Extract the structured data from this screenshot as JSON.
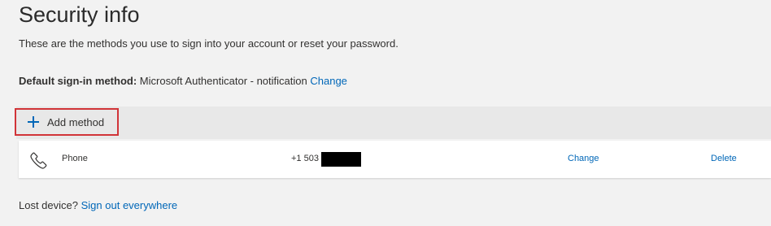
{
  "header": {
    "title": "Security info",
    "subtitle": "These are the methods you use to sign into your account or reset your password."
  },
  "default_method": {
    "label": "Default sign-in method:",
    "value": "Microsoft Authenticator - notification",
    "change_link": "Change"
  },
  "add_method": {
    "label": "Add method",
    "icon": "plus-icon",
    "highlight_color": "#d13438"
  },
  "methods": [
    {
      "icon": "phone-icon",
      "type": "Phone",
      "value": "+1 503",
      "value_redacted": true,
      "change_label": "Change",
      "delete_label": "Delete"
    }
  ],
  "footer": {
    "text": "Lost device?",
    "link": "Sign out everywhere"
  },
  "colors": {
    "link": "#0067b8",
    "page_background": "#f2f2f2"
  }
}
